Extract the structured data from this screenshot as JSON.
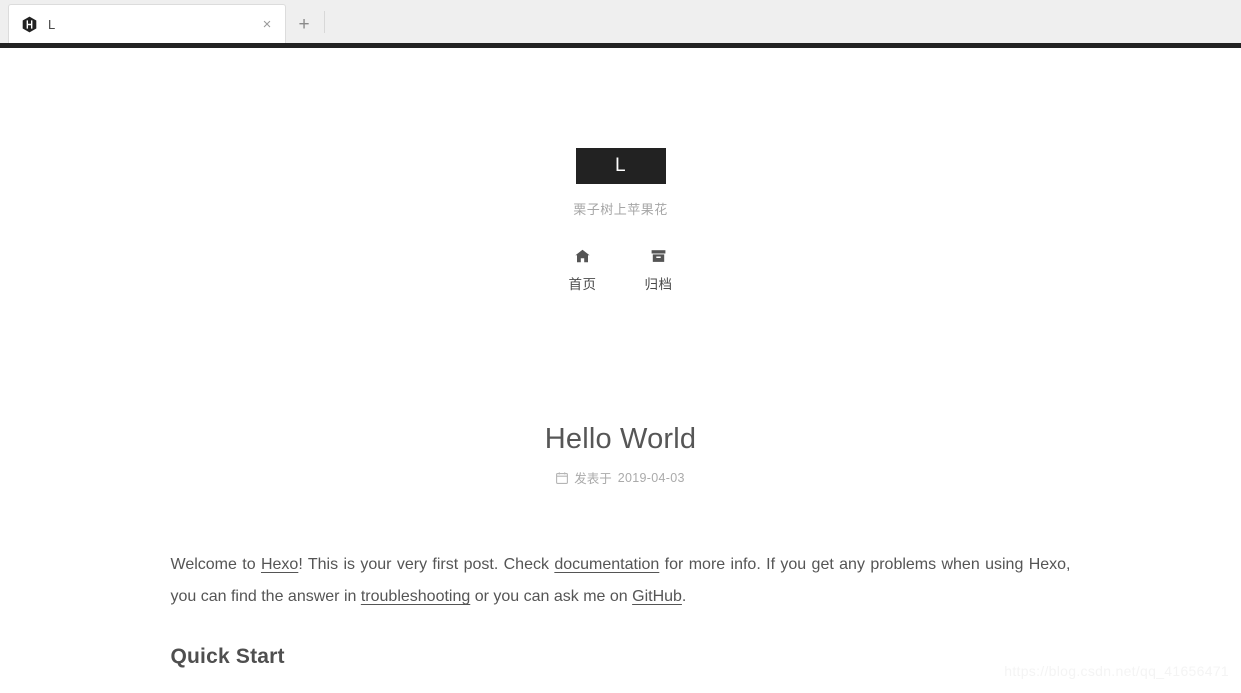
{
  "browser": {
    "tab": {
      "title": "L",
      "favicon_name": "hexo-logo-icon",
      "close_label": "×"
    },
    "new_tab_label": "+"
  },
  "site": {
    "logo_text": "L",
    "subtitle": "栗子树上苹果花",
    "nav": [
      {
        "label": "首页",
        "icon": "home-icon"
      },
      {
        "label": "归档",
        "icon": "archive-box-icon"
      }
    ]
  },
  "post": {
    "title": "Hello World",
    "meta": {
      "icon": "calendar-icon",
      "prefix": "发表于",
      "date": "2019-04-03"
    },
    "paragraph": {
      "part1": "Welcome to ",
      "link_hexo": "Hexo",
      "part2": "! This is your very first post. Check ",
      "link_documentation": "documentation",
      "part3": " for more info. If you get any problems when using Hexo, you can find the answer in ",
      "link_troubleshooting": "troubleshooting",
      "part4": " or you can ask me on ",
      "link_github": "GitHub",
      "part5": "."
    },
    "heading_quick_start": "Quick Start"
  },
  "watermark": "https://blog.csdn.net/qq_41656471",
  "colors": {
    "chrome_bg": "#efefef",
    "dark_bar": "#222222",
    "logo_bg": "#222222",
    "text": "#555555",
    "muted": "#aaaaaa"
  }
}
